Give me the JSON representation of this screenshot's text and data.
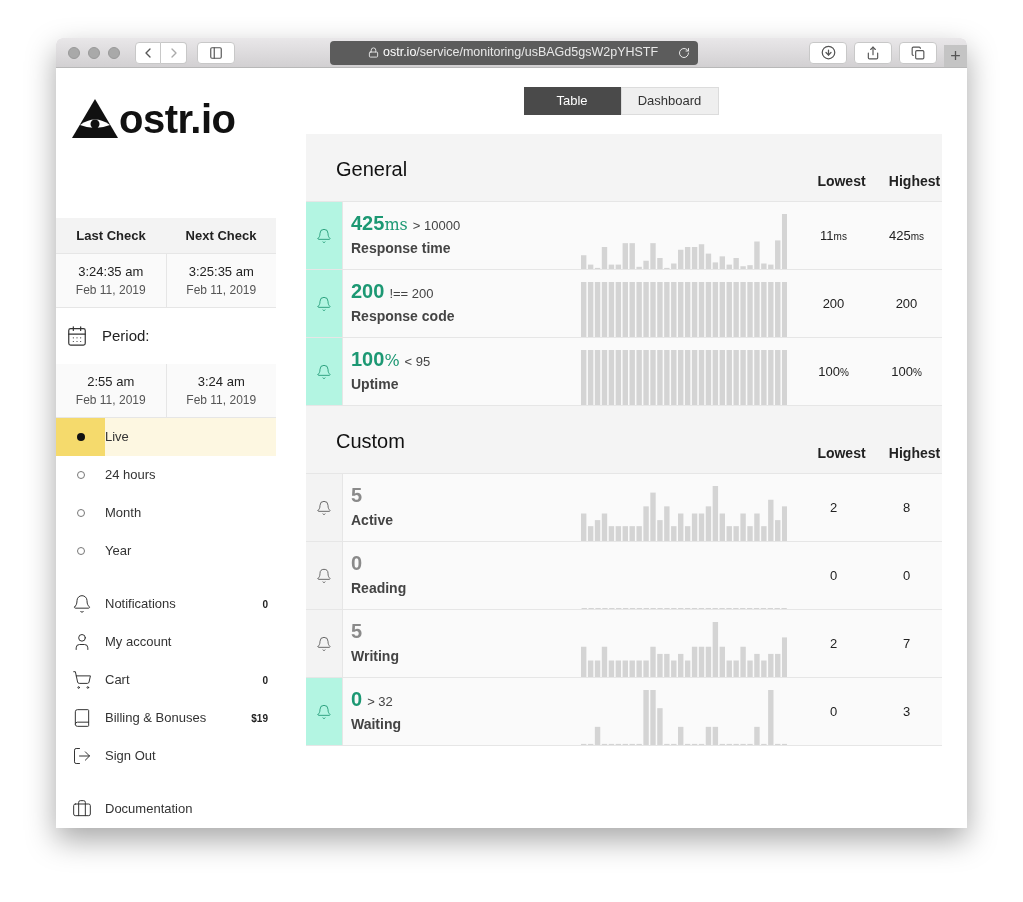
{
  "browser": {
    "url_host": "ostr.io",
    "url_path": "/service/monitoring/usBAGd5gsW2pYHSTF",
    "new_tab": "+"
  },
  "logo": {
    "text": "ostr.io"
  },
  "checks": {
    "columns": [
      "Last Check",
      "Next Check"
    ],
    "cells": [
      {
        "time": "3:24:35 am",
        "date": "Feb 11, 2019"
      },
      {
        "time": "3:25:35 am",
        "date": "Feb 11, 2019"
      }
    ]
  },
  "period": {
    "label": "Period:",
    "range": [
      {
        "time": "2:55 am",
        "date": "Feb 11, 2019"
      },
      {
        "time": "3:24 am",
        "date": "Feb 11, 2019"
      }
    ],
    "options": [
      {
        "label": "Live",
        "selected": true
      },
      {
        "label": "24 hours",
        "selected": false
      },
      {
        "label": "Month",
        "selected": false
      },
      {
        "label": "Year",
        "selected": false
      }
    ]
  },
  "menu": [
    {
      "label": "Notifications",
      "badge": "0"
    },
    {
      "label": "My account"
    },
    {
      "label": "Cart",
      "badge": "0"
    },
    {
      "label": "Billing & Bonuses",
      "badge": "$19"
    },
    {
      "label": "Sign Out"
    },
    {
      "label": "Documentation"
    }
  ],
  "view_tabs": [
    {
      "label": "Table",
      "selected": true
    },
    {
      "label": "Dashboard",
      "selected": false
    }
  ],
  "sections": [
    {
      "title": "General",
      "columns": [
        "Lowest",
        "Highest"
      ],
      "rows": [
        {
          "alert": true,
          "value": "425",
          "unit": "ms",
          "condition": "> 10000",
          "name": "Response time",
          "lowest": "11",
          "lowest_unit": "ms",
          "highest": "425",
          "highest_unit": "ms"
        },
        {
          "alert": true,
          "value": "200",
          "condition": "!== 200",
          "name": "Response code",
          "lowest": "200",
          "highest": "200"
        },
        {
          "alert": true,
          "value": "100",
          "unit": "%",
          "condition": "< 95",
          "name": "Uptime",
          "lowest": "100",
          "lowest_unit": "%",
          "highest": "100",
          "highest_unit": "%"
        }
      ]
    },
    {
      "title": "Custom",
      "columns": [
        "Lowest",
        "Highest"
      ],
      "rows": [
        {
          "alert": false,
          "value": "5",
          "name": "Active",
          "lowest": "2",
          "highest": "8"
        },
        {
          "alert": false,
          "value": "0",
          "name": "Reading",
          "lowest": "0",
          "highest": "0"
        },
        {
          "alert": false,
          "value": "5",
          "name": "Writing",
          "lowest": "2",
          "highest": "7"
        },
        {
          "alert": true,
          "value": "0",
          "condition": "> 32",
          "name": "Waiting",
          "lowest": "0",
          "highest": "3"
        }
      ]
    }
  ]
}
